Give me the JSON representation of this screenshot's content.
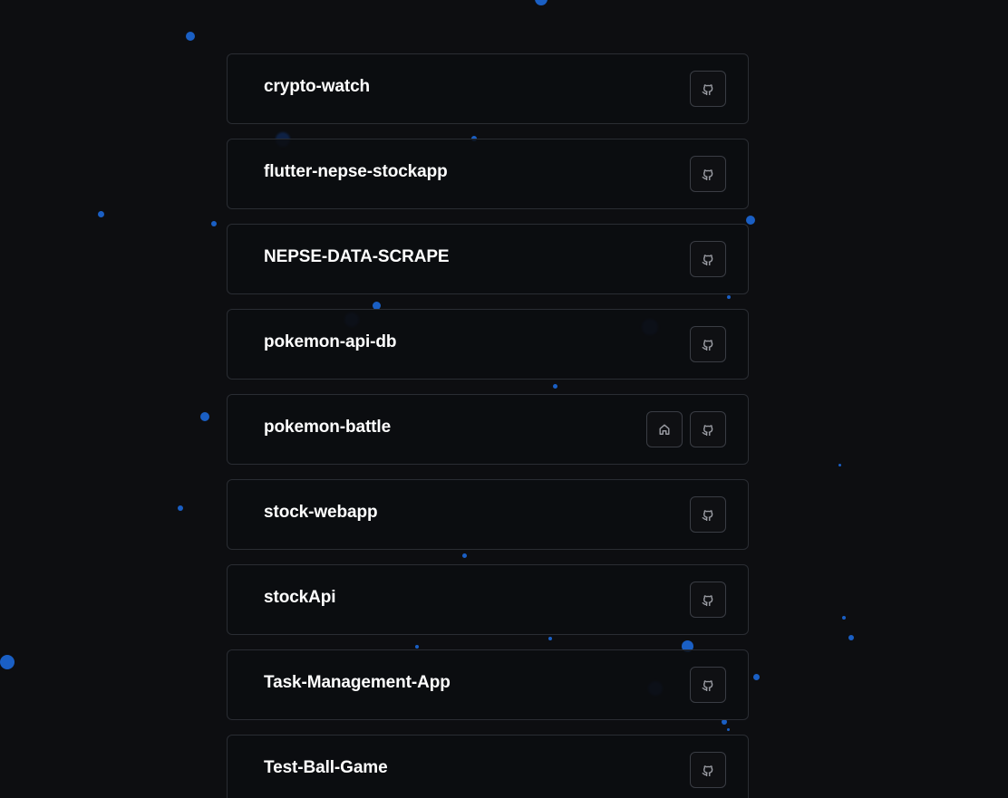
{
  "projects": [
    {
      "name": "crypto-watch",
      "buttons": [
        "github-icon"
      ]
    },
    {
      "name": "flutter-nepse-stockapp",
      "buttons": [
        "github-icon"
      ]
    },
    {
      "name": "NEPSE-DATA-SCRAPE",
      "buttons": [
        "github-icon"
      ]
    },
    {
      "name": "pokemon-api-db",
      "buttons": [
        "github-icon"
      ]
    },
    {
      "name": "pokemon-battle",
      "buttons": [
        "home-icon",
        "github-icon"
      ]
    },
    {
      "name": "stock-webapp",
      "buttons": [
        "github-icon"
      ]
    },
    {
      "name": "stockApi",
      "buttons": [
        "github-icon"
      ]
    },
    {
      "name": "Task-Management-App",
      "buttons": [
        "github-icon"
      ]
    },
    {
      "name": "Test-Ball-Game",
      "buttons": [
        "github-icon"
      ]
    }
  ],
  "colors": {
    "background": "#0d0e11",
    "card_border": "#2a2d33",
    "accent_dot": "#1a5fc4",
    "title": "#ffffff"
  }
}
